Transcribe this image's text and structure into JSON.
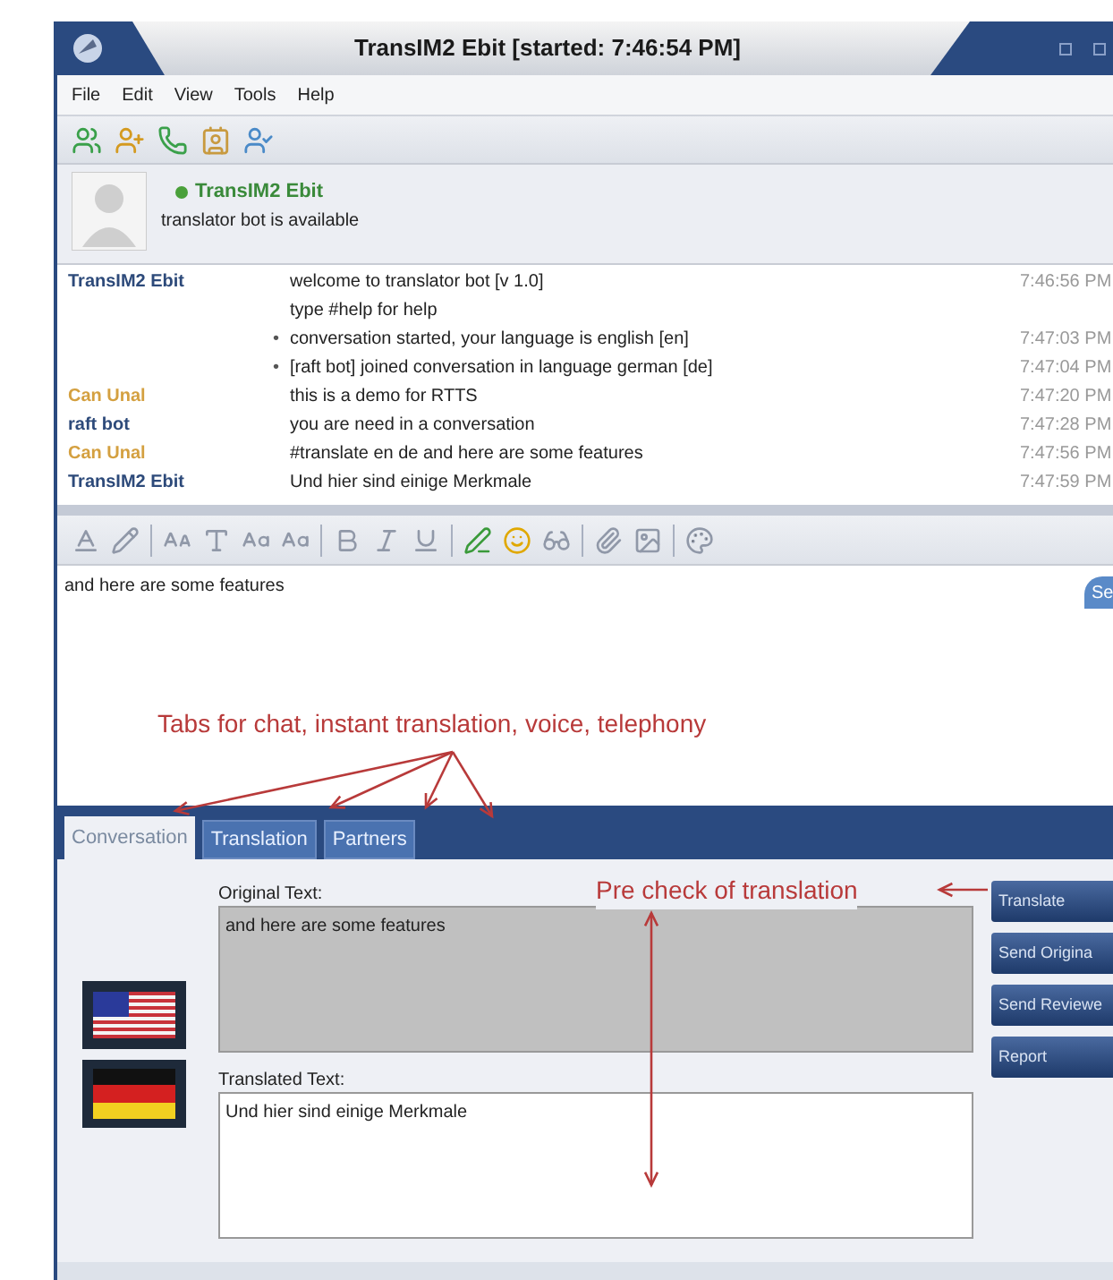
{
  "window": {
    "title": "TransIM2 Ebit [started: 7:46:54 PM]"
  },
  "menu": [
    "File",
    "Edit",
    "View",
    "Tools",
    "Help"
  ],
  "contact": {
    "name": "TransIM2 Ebit",
    "status": "translator bot is available",
    "online": true
  },
  "chat_log": [
    {
      "sender": "TransIM2 Ebit",
      "color": "#2d4a7a",
      "lines": [
        "welcome to translator bot [v 1.0]",
        "type #help for help"
      ],
      "time": "7:46:56 PM"
    },
    {
      "marker": "•",
      "lines": [
        "conversation started, your language is english [en]"
      ],
      "time": "7:47:03 PM"
    },
    {
      "marker": "•",
      "lines": [
        "[raft bot] joined conversation in language german [de]"
      ],
      "time": "7:47:04 PM"
    },
    {
      "sender": "Can Unal",
      "color": "#d4a040",
      "lines": [
        "this is a demo for RTTS"
      ],
      "time": "7:47:20 PM"
    },
    {
      "sender": "raft bot",
      "color": "#2d4a7a",
      "lines": [
        "you are need in a conversation"
      ],
      "time": "7:47:28 PM"
    },
    {
      "sender": "Can Unal",
      "color": "#d4a040",
      "lines": [
        "#translate en de and here are some features"
      ],
      "time": "7:47:56 PM"
    },
    {
      "sender": "TransIM2 Ebit",
      "color": "#2d4a7a",
      "lines": [
        "Und hier sind einige Merkmale"
      ],
      "time": "7:47:59 PM"
    }
  ],
  "composer": {
    "value": "and here are some features",
    "send": "Se"
  },
  "annotations": [
    "Tabs for chat, instant translation, voice, telephony",
    "Pre check of translation"
  ],
  "tabs": [
    {
      "label": "Conversation",
      "selected": true
    },
    {
      "label": "Translation",
      "selected": false
    },
    {
      "label": "Partners",
      "selected": false
    }
  ],
  "translation": {
    "original_label": "Original Text:",
    "original_value": "and here are some features",
    "translated_label": "Translated Text:",
    "translated_value": "Und hier sind einige Merkmale"
  },
  "buttons": [
    "Translate",
    "Send Origina",
    "Send Reviewe",
    "Report"
  ]
}
